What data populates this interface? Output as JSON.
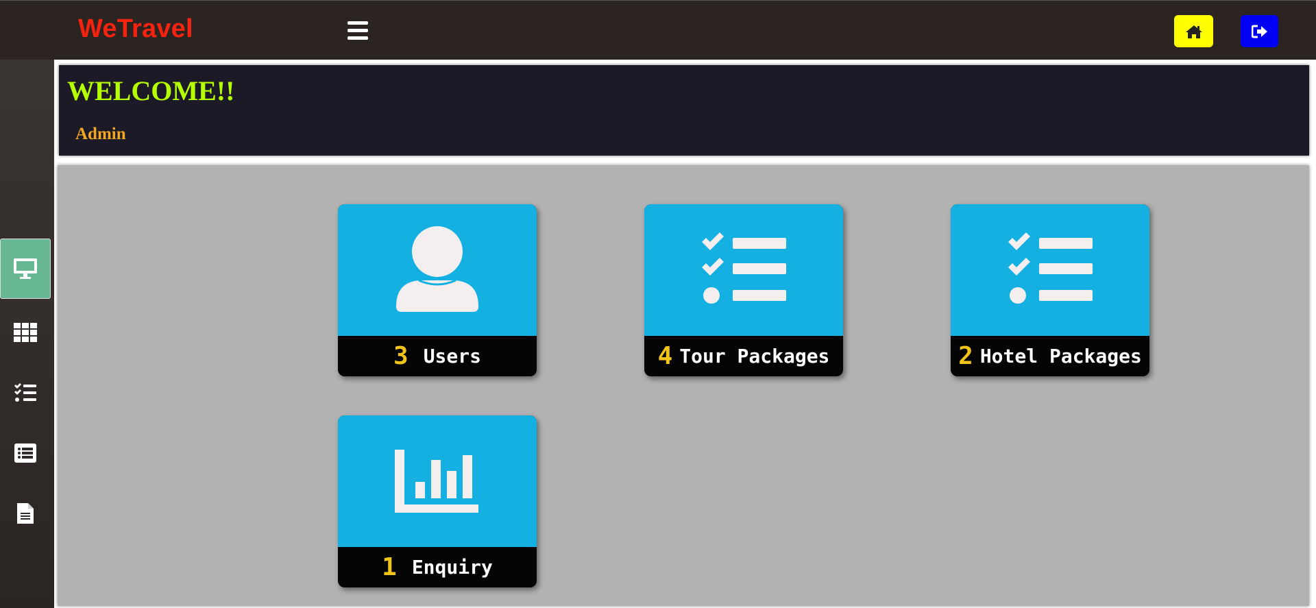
{
  "app": {
    "brand": "WeTravel"
  },
  "header": {
    "home_icon": "home-icon",
    "logout_icon": "sign-out-icon"
  },
  "sidebar": {
    "items": [
      {
        "icon": "desktop-icon",
        "active": true
      },
      {
        "icon": "grid-icon",
        "active": false
      },
      {
        "icon": "tasks-icon",
        "active": false
      },
      {
        "icon": "list-alt-icon",
        "active": false
      },
      {
        "icon": "file-text-icon",
        "active": false
      }
    ],
    "active_color": "#67b892"
  },
  "welcome": {
    "title": "WELCOME!!",
    "user": "Admin"
  },
  "cards": [
    {
      "count": "3",
      "label": "Users",
      "icon": "user-icon"
    },
    {
      "count": "4",
      "label": "Tour Packages",
      "icon": "tasks-icon"
    },
    {
      "count": "2",
      "label": "Hotel Packages",
      "icon": "tasks-icon"
    },
    {
      "count": "1",
      "label": "Enquiry",
      "icon": "bar-chart-icon"
    }
  ],
  "colors": {
    "brand": "#f5230f",
    "topbar": "#2b2421",
    "home_button": "#ffff00",
    "logout_button": "#0000f5",
    "card": "#14b0e2",
    "count": "#f2c418",
    "welcome_title": "#b6ff00",
    "welcome_user": "#f2a623",
    "panel": "#b2b2b2"
  }
}
